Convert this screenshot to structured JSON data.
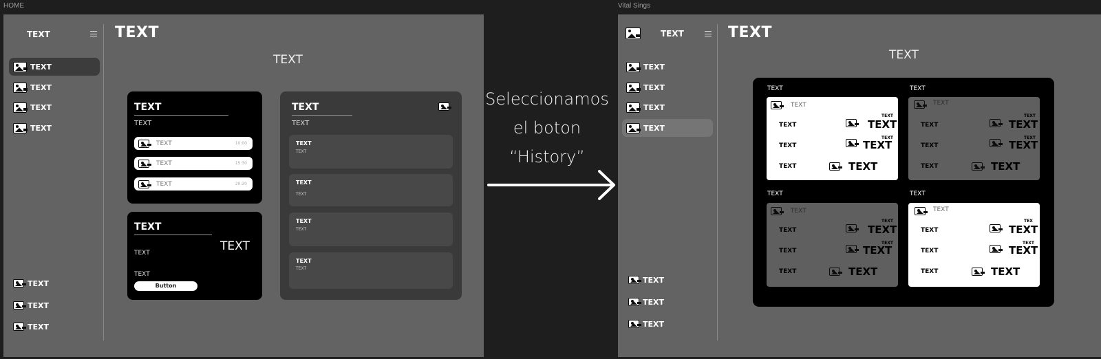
{
  "left_frame": {
    "label": "HOME",
    "sidebar": {
      "title": "TEXT",
      "items": [
        {
          "label": "TEXT",
          "active": true
        },
        {
          "label": "TEXT",
          "active": false
        },
        {
          "label": "TEXT",
          "active": false
        },
        {
          "label": "TEXT",
          "active": false
        }
      ],
      "bottom_items": [
        {
          "label": "TEXT"
        },
        {
          "label": "TEXT"
        },
        {
          "label": "TEXT"
        }
      ]
    },
    "header_title": "TEXT",
    "center_title": "TEXT",
    "card1": {
      "title": "TEXT",
      "subtitle": "TEXT",
      "rows": [
        {
          "label": "TEXT",
          "time": "10:00"
        },
        {
          "label": "TEXT",
          "time": "15:30"
        },
        {
          "label": "TEXT",
          "time": "20:30"
        }
      ]
    },
    "card2": {
      "title": "TEXT",
      "subtitle": "TEXT",
      "big": "TEXT",
      "label2": "TEXT",
      "button": "Button"
    },
    "card3": {
      "title": "TEXT",
      "subtitle": "TEXT",
      "items": [
        {
          "title": "TEXT",
          "sub": "TEXT"
        },
        {
          "title": "TEXT",
          "sub": "TEXT"
        },
        {
          "title": "TEXT",
          "sub": "TEXT"
        },
        {
          "title": "TEXT",
          "sub": "TEXT"
        }
      ]
    }
  },
  "middle": {
    "lines": [
      "Seleccionamos",
      "el boton",
      "“History”"
    ],
    "arrow_icon": "arrow-right-icon"
  },
  "right_frame": {
    "label": "Vital Sings",
    "sidebar": {
      "title": "TEXT",
      "items": [
        {
          "label": "TEXT",
          "active": false
        },
        {
          "label": "TEXT",
          "active": false
        },
        {
          "label": "TEXT",
          "active": false
        },
        {
          "label": "TEXT",
          "active": true
        }
      ],
      "bottom_items": [
        {
          "label": "TEXT"
        },
        {
          "label": "TEXT"
        },
        {
          "label": "TEXT"
        }
      ]
    },
    "header_title": "TEXT",
    "center_title": "TEXT",
    "vitals": [
      {
        "label": "TEXT",
        "head": "TEXT",
        "style": "white",
        "rows": [
          {
            "label": "TEXT",
            "small": "TEXT",
            "value": "TEXT"
          },
          {
            "label": "TEXT",
            "small": "TEXT",
            "value": "TEXT"
          },
          {
            "label": "TEXT",
            "small": "",
            "value": "TEXT"
          }
        ]
      },
      {
        "label": "TEXT",
        "head": "TEXT",
        "style": "gray",
        "rows": [
          {
            "label": "TEXT",
            "small": "TEXT",
            "value": "TEXT"
          },
          {
            "label": "TEXT",
            "small": "TEXT",
            "value": "TEXT"
          },
          {
            "label": "TEXT",
            "small": "",
            "value": "TEXT"
          }
        ]
      },
      {
        "label": "TEXT",
        "head": "TEXT",
        "style": "gray",
        "rows": [
          {
            "label": "TEXT",
            "small": "TEXT",
            "value": "TEXT"
          },
          {
            "label": "TEXT",
            "small": "TEXT",
            "value": "TEXT"
          },
          {
            "label": "TEXT",
            "small": "",
            "value": "TEXT"
          }
        ]
      },
      {
        "label": "TEXT",
        "head": "TEXT",
        "style": "white",
        "rows": [
          {
            "label": "TEXT",
            "small": "TEX",
            "value": "TEXT"
          },
          {
            "label": "TEXT",
            "small": "TEXT",
            "value": "TEXT"
          },
          {
            "label": "TEXT",
            "small": "",
            "value": "TEXT"
          }
        ]
      }
    ]
  }
}
